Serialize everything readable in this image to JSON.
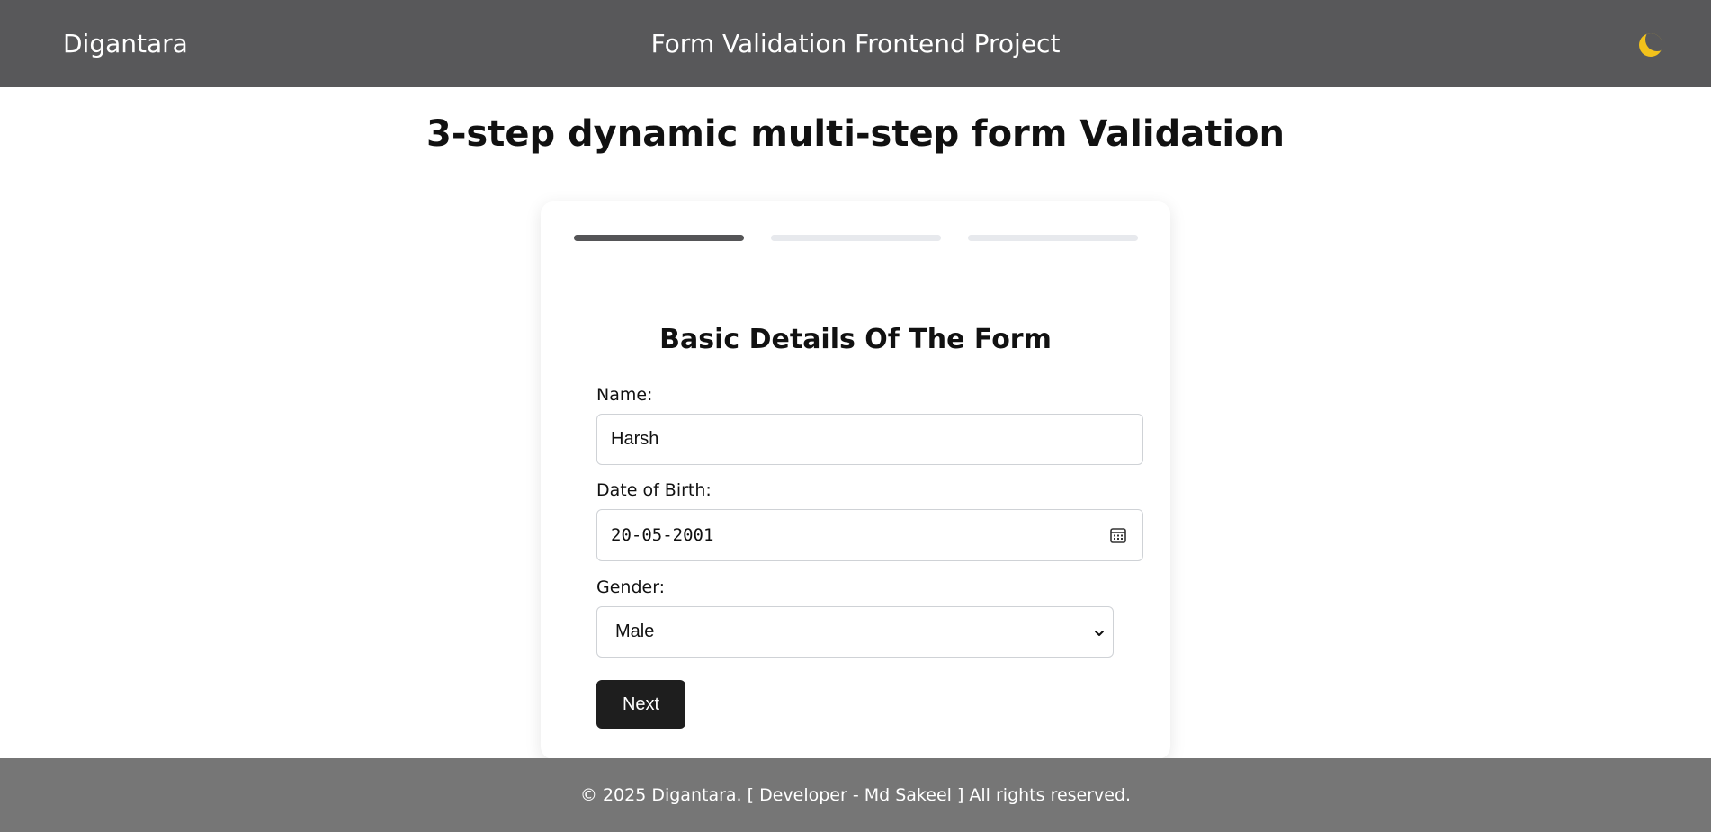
{
  "header": {
    "brand": "Digantara",
    "title": "Form Validation Frontend Project",
    "theme_toggle_icon": "moon-icon"
  },
  "page": {
    "heading": "3-step dynamic multi-step form Validation"
  },
  "progress": {
    "current_step": 1,
    "total_steps": 3
  },
  "form": {
    "title": "Basic Details Of The Form",
    "name_label": "Name:",
    "name_value": "Harsh",
    "dob_label": "Date of Birth:",
    "dob_value": "20-05-2001",
    "gender_label": "Gender:",
    "gender_value": "Male",
    "next_label": "Next"
  },
  "footer": {
    "text": "© 2025 Digantara. [ Developer - Md Sakeel ] All rights reserved."
  },
  "colors": {
    "navbar": "#58585a",
    "footer": "#767676",
    "active_step": "#555557",
    "inactive_step": "#e7e9ed",
    "button": "#1e1e1e",
    "moon": "#f2c21b"
  }
}
